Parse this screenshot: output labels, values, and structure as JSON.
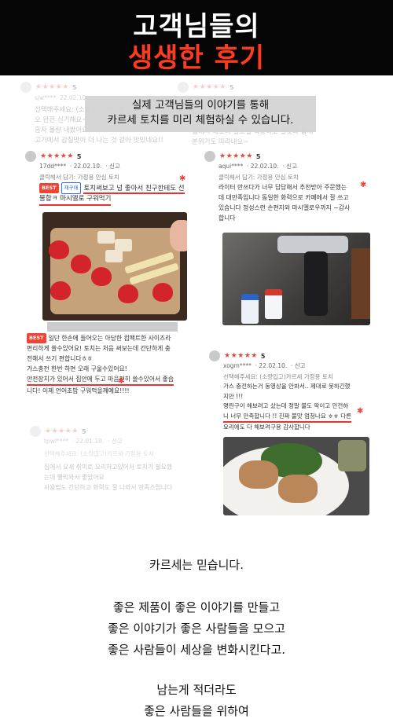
{
  "header": {
    "title_line1": "고객님들의",
    "title_line2": "생생한 후기",
    "title_line2_color": "#ff3b1f"
  },
  "banner": {
    "line1": "실제 고객님들의 이야기를 통해",
    "line2": "카르세 토치를 미리 체험하실 수 있습니다."
  },
  "reviews": [
    {
      "id": "r1",
      "stars": "★★★★★",
      "score": "5",
      "author": "17dd****",
      "date": "22.02.10.",
      "report": "신고",
      "option": "클릭해서 담기: 가정용 안심 토치",
      "best_badge": "BEST",
      "repurchase_badge": "재구매",
      "lines": [
        "토치써보고 넘 좋아서 친구한테도 선",
        "물함ㅋ 마시멜로 구워먹기"
      ],
      "lines_after": []
    },
    {
      "id": "r2",
      "stars": "★★★★★",
      "score": "5",
      "author": "aqui****",
      "date": "22.02.10.",
      "report": "신고",
      "option": "클릭해서 담기: 가정용 안심 토치",
      "lines": [
        "라이터 만쓰다가 너무 답답해서 추천받아 주문했는",
        "데 대만족입니다 동일한 화력으로 카페에서 잘 쓰고",
        "있습니다  정성스런 손편지와 마시멜로우까지 ~감사",
        "합니다"
      ]
    },
    {
      "id": "r3",
      "best_badge": "BEST",
      "lines": [
        "일단 한손에 들어오는 아담한 컴팩트한 사이즈라",
        "편리하게 쓸수있어요! 토치는 처음 써보는데 간단하게 충",
        "전해서 쓰기 편합니다ㅎㅎ",
        "가스충전 한번 하면 오래 구울수있어요!",
        "안전장치가 있어서 집안에 두고 마음편히 쓸수있어서 좋습",
        "니다! 이제 언어초밥 구워먹을께예요!!!!"
      ]
    },
    {
      "id": "r4",
      "stars": "★★★★★",
      "score": "5",
      "author": "xogm****",
      "date": "22.02.10.",
      "report": "신고",
      "option": "선택해주세요: (소량입고)카르세 가정용 토치",
      "lines": [
        "가스 충전하는거 동영상을 안봐서.. 제대로 못하긴했",
        "지만 !!!",
        "명란구이 해보려고 샀는데 정말 불도 딱이고 안전하",
        "니 너무 만족합니다 !! 진짜 불맛 엄청나요 ㅎㅎ 다른",
        "요리에도 다 해보려구용 감사합니다"
      ]
    },
    {
      "id": "r5-faded",
      "stars": "★★★★★",
      "score": "5",
      "author": "tpwl****",
      "date": "22.01.19.",
      "report": "신고",
      "option": "선택해주세요: (소량입고)카르세 가정용 토치",
      "lines": [
        "집에서 요새 취미로 요리하고있어서 토치가 필요했",
        "는데 빨리와서 좋았어요",
        "사용법도 간단하고 화력도 잘 나와서 만족스럽니다"
      ]
    },
    {
      "id": "r0a-faded",
      "stars": "★★★★★",
      "score": "5",
      "author": "sjw****",
      "date": "22.02.10.",
      "lines": [
        "선택해주세요: (소량입고)카르세",
        "오 완전 신기해요~",
        "혼자 불량 내봤어요",
        "고기에서 감칠맛이 더 나는 것 같아 맛있네요!!"
      ]
    },
    {
      "id": "r0b-faded",
      "stars": "★★★★★",
      "score": "5",
      "lines": [
        "집에서 해보니 불조절 적당하고 불맛과 함께",
        "분위기도 따라내요~"
      ]
    }
  ],
  "message": {
    "line1": "카르세는 믿습니다.",
    "line2": "좋은 제품이 좋은 이야기를 만들고",
    "line3": "좋은 이야기가 좋은 사람들을 모으고",
    "line4": "좋은 사람들이 세상을 변화시킨다고.",
    "line5": "남는게 적더라도",
    "line6": "좋은 사람들을 위하여"
  }
}
